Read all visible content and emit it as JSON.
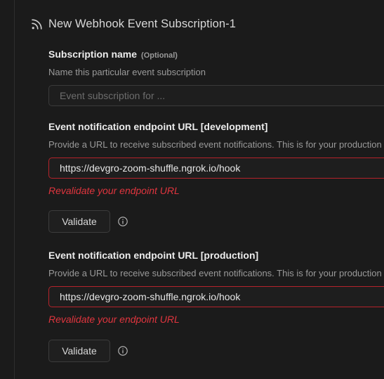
{
  "header": {
    "title": "New Webhook Event Subscription-1",
    "icon": "rss-feed-icon"
  },
  "subscription_name": {
    "label": "Subscription name",
    "optional_tag": "(Optional)",
    "help": "Name this particular event subscription",
    "placeholder": "Event subscription for ...",
    "value": ""
  },
  "endpoint_development": {
    "label": "Event notification endpoint URL [development]",
    "help": "Provide a URL to receive subscribed event notifications. This is for your production",
    "value": "https://devgro-zoom-shuffle.ngrok.io/hook",
    "error": "Revalidate your endpoint URL",
    "validate_label": "Validate",
    "info_icon": "info-icon"
  },
  "endpoint_production": {
    "label": "Event notification endpoint URL [production]",
    "help": "Provide a URL to receive subscribed event notifications. This is for your production",
    "value": "https://devgro-zoom-shuffle.ngrok.io/hook",
    "error": "Revalidate your endpoint URL",
    "validate_label": "Validate",
    "info_icon": "info-icon"
  },
  "colors": {
    "background": "#1b1b1b",
    "error": "#e0353e",
    "error_border": "#b5232b"
  }
}
